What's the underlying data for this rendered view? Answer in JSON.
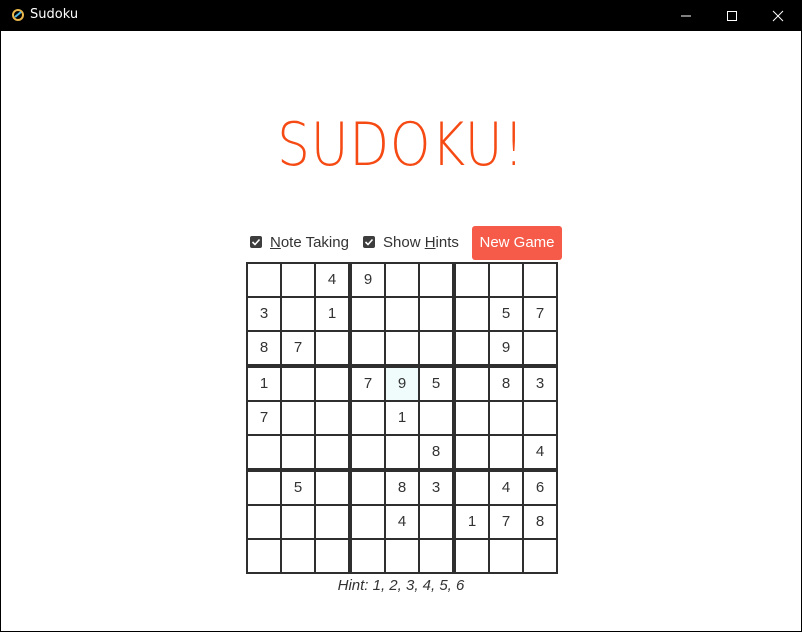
{
  "window": {
    "title": "Sudoku"
  },
  "heading": "SUDOKU!",
  "controls": {
    "note_taking": {
      "label_underlined": "N",
      "label_rest": "ote Taking",
      "checked": true
    },
    "show_hints": {
      "label_prefix": "Show ",
      "label_underlined": "H",
      "label_rest": "ints",
      "checked": true
    },
    "new_game_label": "New Game"
  },
  "board": {
    "rows": [
      [
        "",
        "",
        "4",
        "9",
        "",
        "",
        "",
        "",
        ""
      ],
      [
        "3",
        "",
        "1",
        "",
        "",
        "",
        "",
        "5",
        "7"
      ],
      [
        "8",
        "7",
        "",
        "",
        "",
        "",
        "",
        "9",
        ""
      ],
      [
        "1",
        "",
        "",
        "7",
        "9",
        "5",
        "",
        "8",
        "3"
      ],
      [
        "7",
        "",
        "",
        "",
        "1",
        "",
        "",
        "",
        ""
      ],
      [
        "",
        "",
        "",
        "",
        "",
        "8",
        "",
        "",
        "4"
      ],
      [
        "",
        "5",
        "",
        "",
        "8",
        "3",
        "",
        "4",
        "6"
      ],
      [
        "",
        "",
        "",
        "",
        "4",
        "",
        "1",
        "7",
        "8"
      ],
      [
        "",
        "",
        "",
        "",
        "",
        "",
        "",
        "",
        ""
      ]
    ],
    "selected": {
      "row": 3,
      "col": 4
    }
  },
  "hint": "Hint: 1, 2, 3, 4, 5, 6",
  "colors": {
    "accent": "#f64a14",
    "button": "#f55b48",
    "grid_line": "#2f2f2f",
    "selected_cell": "#f0fcfc"
  }
}
